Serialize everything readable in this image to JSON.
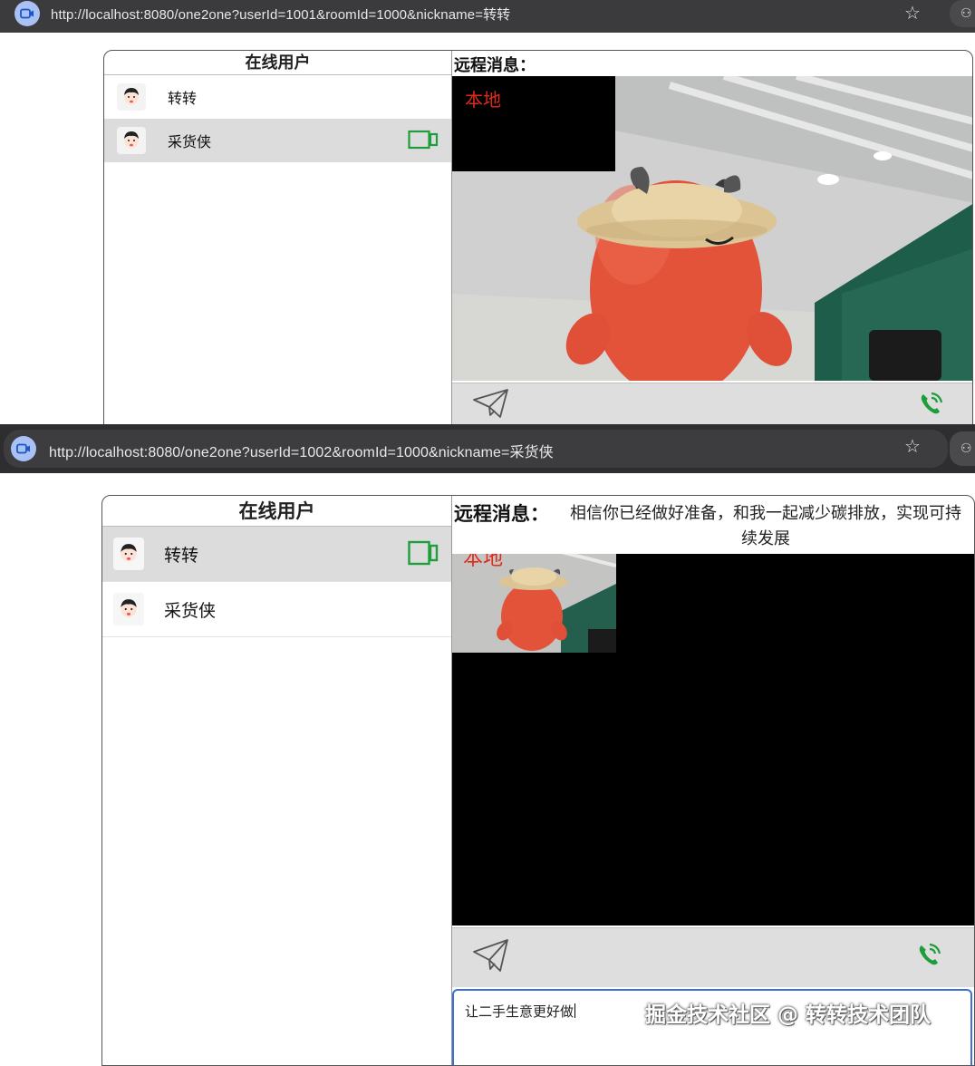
{
  "window1": {
    "url": "http://localhost:8080/one2one?userId=1001&roomId=1000&nickname=转转",
    "online_users_title": "在线用户",
    "users": [
      {
        "name": "转转",
        "active": false,
        "has_video": false
      },
      {
        "name": "采货侠",
        "active": true,
        "has_video": true
      }
    ],
    "remote_label": "远程消息：",
    "remote_message": "",
    "local_label": "本地"
  },
  "window2": {
    "url": "http://localhost:8080/one2one?userId=1002&roomId=1000&nickname=采货侠",
    "online_users_title": "在线用户",
    "users": [
      {
        "name": "转转",
        "active": true,
        "has_video": true
      },
      {
        "name": "采货侠",
        "active": false,
        "has_video": false
      }
    ],
    "remote_label": "远程消息：",
    "remote_message": "相信你已经做好准备，和我一起减少碳排放，实现可持续发展",
    "local_label": "本地",
    "input_value": "让二手生意更好做"
  },
  "watermark": "掘金技术社区 @ 转转技术团队",
  "colors": {
    "accent_green": "#1e9e3a",
    "local_label_red": "#e02a1a",
    "input_border_blue": "#3d6fd6"
  },
  "icons": [
    "video-camera-icon",
    "send-icon",
    "phone-call-icon",
    "star-icon",
    "site-video-icon",
    "avatar-icon"
  ]
}
